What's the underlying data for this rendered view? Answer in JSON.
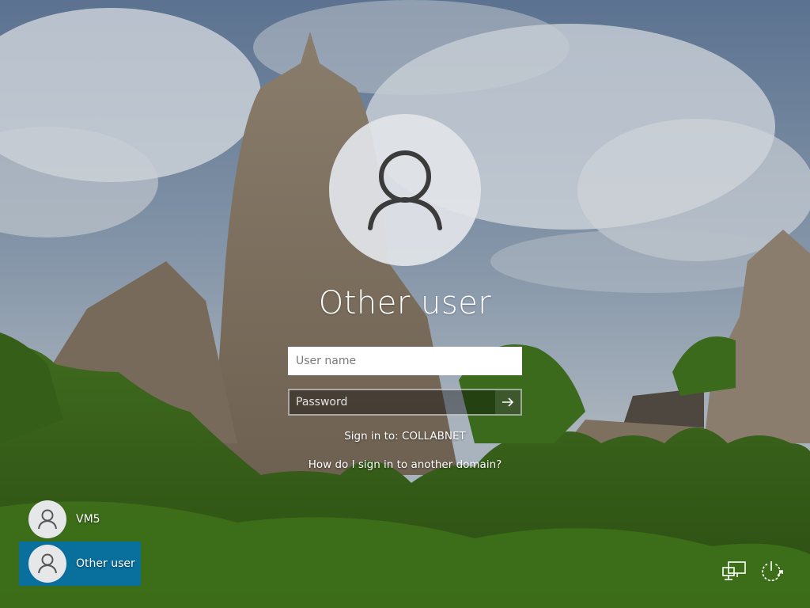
{
  "login": {
    "title": "Other user",
    "username_placeholder": "User name",
    "password_placeholder": "Password",
    "sign_in_to": "Sign in to: COLLABNET",
    "domain_help_link": "How do I sign in to another domain?"
  },
  "users": [
    {
      "label": "VM5",
      "selected": false
    },
    {
      "label": "Other user",
      "selected": true
    }
  ],
  "system_icons": [
    "network-icon",
    "power-icon"
  ],
  "colors": {
    "selected_tile": "#0070b4",
    "input_bg": "#ffffff"
  }
}
